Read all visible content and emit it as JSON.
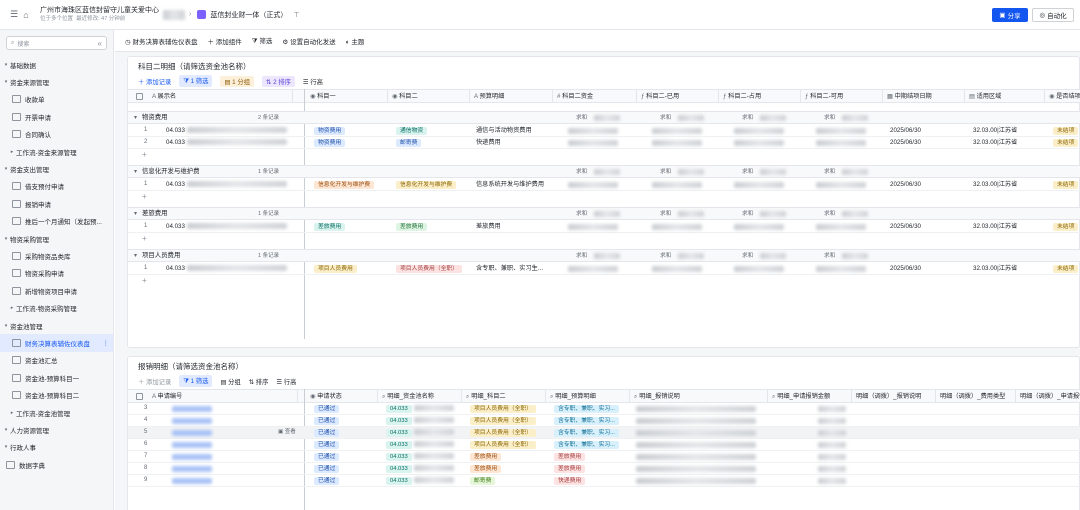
{
  "topbar": {
    "crumb_main": "广州市海珠区蓝信封留守儿童关爱中心",
    "crumb_sub1": "位于多个位置",
    "crumb_sub2": "最近修改: 47 分钟前",
    "doc_title": "蓝信封业财一体（正式）",
    "share": "分享",
    "automation": "自动化"
  },
  "sidebar": {
    "search_placeholder": "搜索",
    "items": [
      {
        "label": "基础数据",
        "level": 0
      },
      {
        "label": "资金来源管理",
        "level": 0
      },
      {
        "label": "收款单",
        "level": 1
      },
      {
        "label": "开票申请",
        "level": 1
      },
      {
        "label": "合同确认",
        "level": 1
      },
      {
        "label": "工作流-资金来源管理",
        "level": 2
      },
      {
        "label": "资金支出管理",
        "level": 0
      },
      {
        "label": "借支预付申请",
        "level": 1
      },
      {
        "label": "报销申请",
        "level": 1
      },
      {
        "label": "推后一个月通知（发起预...",
        "level": 1
      },
      {
        "label": "物资采购管理",
        "level": 0
      },
      {
        "label": "采购物资品类库",
        "level": 1
      },
      {
        "label": "物资采购申请",
        "level": 1
      },
      {
        "label": "新增物资项目申请",
        "level": 1
      },
      {
        "label": "工作流-物资采购管理",
        "level": 2
      },
      {
        "label": "资金池管理",
        "level": 0
      },
      {
        "label": "财务决算表辅佐仪表盘",
        "level": 1,
        "active": true
      },
      {
        "label": "资金池汇总",
        "level": 1
      },
      {
        "label": "资金池-预算科目一",
        "level": 1
      },
      {
        "label": "资金池-预算科目二",
        "level": 1
      },
      {
        "label": "工作流-资金池管理",
        "level": 2
      },
      {
        "label": "人力资源管理",
        "level": 0
      },
      {
        "label": "行政人事",
        "level": 0
      },
      {
        "label": "数据字典",
        "level": 3
      }
    ]
  },
  "dash_bar": {
    "title": "财务决算表辅佐仪表盘",
    "add": "添加组件",
    "filter": "筛选",
    "auto_send": "设置自动化发送",
    "theme": "主题"
  },
  "card1": {
    "title": "科目二明细（请筛选资金池名称）",
    "toolbar": {
      "add": "添加记录",
      "filter": "1 筛选",
      "group": "1 分组",
      "sort": "2 排序",
      "rowh": "行高"
    },
    "headers": [
      "展示名",
      "科目一",
      "科目二",
      "预算明细",
      "科目二资金",
      "科目二-已用",
      "科目二-占用",
      "科目二-可用",
      "中期结项日期",
      "适用区域",
      "是否结项"
    ],
    "sum_label": "求和",
    "groups": [
      {
        "name": "物资费用",
        "count": "2 条记录",
        "rows": [
          {
            "no": "1",
            "name": "04.033",
            "k1": "物资费用",
            "k2": "通信物资",
            "detail": "通信与活动物资费用",
            "date": "2025/06/30",
            "area": "32.03.00|江苏省",
            "done": "未结项"
          },
          {
            "no": "2",
            "name": "04.033",
            "k1": "物资费用",
            "k2": "邮寄费",
            "detail": "快递费用",
            "date": "2025/06/30",
            "area": "32.03.00|江苏省",
            "done": "未结项"
          }
        ]
      },
      {
        "name": "信息化开发与维护费",
        "count": "1 条记录",
        "rows": [
          {
            "no": "1",
            "name": "04.033",
            "k1": "信息化开发与维护费",
            "k2": "信息化开发与维护费",
            "detail": "信息系统开发与维护费用",
            "date": "2025/06/30",
            "area": "32.03.00|江苏省",
            "done": "未结项"
          }
        ]
      },
      {
        "name": "差旅费用",
        "count": "1 条记录",
        "rows": [
          {
            "no": "1",
            "name": "04.033",
            "k1": "差旅费用",
            "k2": "差旅费用",
            "detail": "差旅费用",
            "date": "2025/06/30",
            "area": "32.03.00|江苏省",
            "done": "未结项"
          }
        ]
      },
      {
        "name": "项目人员费用",
        "count": "1 条记录",
        "rows": [
          {
            "no": "1",
            "name": "04.033",
            "k1": "项目人员费用",
            "k2": "项目人员费用（全职）",
            "detail": "含专职、兼职、实习生...",
            "date": "2025/06/30",
            "area": "32.03.00|江苏省",
            "done": "未结项"
          }
        ]
      }
    ]
  },
  "card2": {
    "title": "报销明细（请筛选资金池名称）",
    "toolbar": {
      "add": "添加记录",
      "filter": "1 筛选",
      "group": "分组",
      "sort": "排序",
      "rowh": "行高"
    },
    "headers": [
      "申请编号",
      "申请状态",
      "明细_资金池名称",
      "明细_科目二",
      "明细_预算明细",
      "明细_报销说明",
      "明细_申请报销金额",
      "明细（调拨）_报销说明",
      "明细（调拨）_费用类型",
      "明细（调拨）_申请报销..."
    ],
    "view_label": "查看",
    "rows": [
      {
        "no": "3",
        "status": "已通过",
        "pool": "04.033",
        "k2": "项目人员费用（全职）",
        "budget": "含专职、兼职、实习..."
      },
      {
        "no": "4",
        "status": "已通过",
        "pool": "04.033",
        "k2": "项目人员费用（全职）",
        "budget": "含专职、兼职、实习..."
      },
      {
        "no": "5",
        "status": "已通过",
        "pool": "04.033",
        "k2": "项目人员费用（全职）",
        "budget": "含专职、兼职、实习..."
      },
      {
        "no": "6",
        "status": "已通过",
        "pool": "04.033",
        "k2": "项目人员费用（全职）",
        "budget": "含专职、兼职、实习..."
      },
      {
        "no": "7",
        "status": "已通过",
        "pool": "04.033",
        "k2": "差旅费用",
        "budget": "差旅费用"
      },
      {
        "no": "8",
        "status": "已通过",
        "pool": "04.033",
        "k2": "差旅费用",
        "budget": "差旅费用"
      },
      {
        "no": "9",
        "status": "已通过",
        "pool": "04.033",
        "k2": "邮寄费",
        "budget": "快递费用"
      }
    ]
  }
}
